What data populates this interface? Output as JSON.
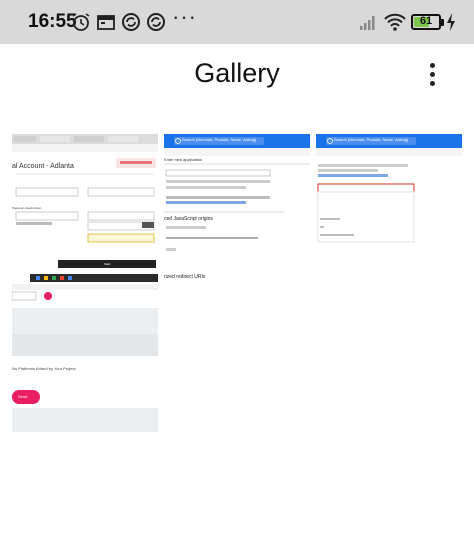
{
  "status_bar": {
    "time": "16:55",
    "icons": [
      "alarm-icon",
      "calendar-icon",
      "sync-icon",
      "sync-icon",
      "more-icon",
      "signal-icon",
      "wifi-icon",
      "battery-icon",
      "charging-icon"
    ],
    "battery_percent": "61",
    "battery_level": 0.61,
    "more": "···"
  },
  "app_bar": {
    "title": "Gallery",
    "menu_icon": "more-vert-icon"
  },
  "thumbnails": [
    {
      "id": "screenshot-1",
      "heading": "al Account - Adlanta",
      "fields": [
        "Passwort wiederholen"
      ],
      "button": "Start",
      "footer_text": "No Platforms Added by Your Project",
      "pink_button": "Send"
    },
    {
      "id": "screenshot-2",
      "search_text": "Search (Nummer, Produkt, Name, Antrag)",
      "subheading": "Enter new application",
      "section": "ced JavaScript origins",
      "section2": "rized redirect URIs"
    },
    {
      "id": "screenshot-3",
      "search_text": "Search (Nummer, Produkt, Name, Antrag)"
    }
  ],
  "colors": {
    "status_bg": "#d9d9d9",
    "accent_blue": "#1a73e8",
    "accent_pink": "#e91e63",
    "battery_green": "#7cc64a"
  }
}
